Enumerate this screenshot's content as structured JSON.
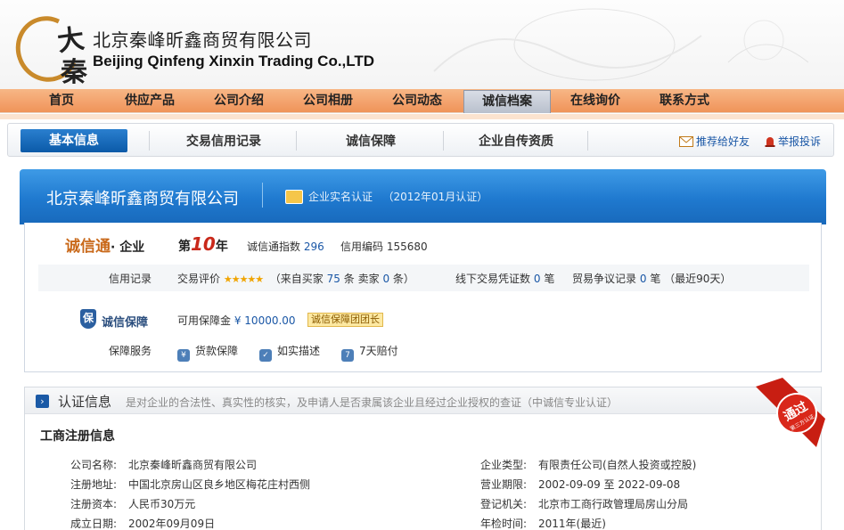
{
  "header": {
    "company_cn": "北京秦峰昕鑫商贸有限公司",
    "company_en": "Beijing Qinfeng Xinxin Trading Co.,LTD",
    "logo_chars": [
      "大",
      "秦"
    ]
  },
  "mainnav": {
    "items": [
      "首页",
      "供应产品",
      "公司介绍",
      "公司相册",
      "公司动态",
      "诚信档案",
      "在线询价",
      "联系方式"
    ],
    "active": "诚信档案"
  },
  "subtabs": {
    "items": [
      "基本信息",
      "交易信用记录",
      "诚信保障",
      "企业自传资质"
    ],
    "active": "基本信息",
    "share": "推荐给好友",
    "report": "举报投诉"
  },
  "banner": {
    "title": "北京秦峰昕鑫商贸有限公司",
    "cert_label": "企业实名认证",
    "cert_date": "（2012年01月认证）"
  },
  "credit": {
    "brand": "诚信通",
    "brand_sub": "· 企业",
    "year_prefix": "第",
    "year_num": "10",
    "year_suffix": "年",
    "index_label": "诚信通指数",
    "index_value": "296",
    "code_label": "信用编码",
    "code_value": "155680",
    "record_label": "信用记录",
    "rating_label": "交易评价",
    "stars": "★★★★★",
    "from_buyer_label": "（来自买家",
    "buyers": "75",
    "tiao1": "条",
    "seller_label": "卖家",
    "sellers": "0",
    "tiao2": "条）",
    "offline_label": "线下交易凭证数",
    "offline_value": "0",
    "bi1": "笔",
    "dispute_label": "贸易争议记录",
    "dispute_value": "0",
    "bi2": "笔",
    "recent": "（最近90天）",
    "guarantee_title": "诚信保障",
    "guarantee_amount_label": "可用保障金",
    "guarantee_amount": "¥ 10000.00",
    "guarantee_tag": "诚信保障团团长",
    "service_label": "保障服务",
    "services": [
      "货款保障",
      "如实描述",
      "7天赔付"
    ]
  },
  "cert": {
    "title": "认证信息",
    "desc": "是对企业的合法性、真实性的核实，及申请人是否隶属该企业且经过企业授权的查证",
    "source": "（中诚信专业认证）",
    "subtitle": "工商注册信息",
    "seal_text": "通过",
    "seal_sub": "第三方认证",
    "fields": [
      {
        "k": "公司名称:",
        "v": "北京秦峰昕鑫商贸有限公司"
      },
      {
        "k": "注册地址:",
        "v": "中国北京房山区良乡地区梅花庄村西侧"
      },
      {
        "k": "注册资本:",
        "v": "人民币30万元"
      },
      {
        "k": "成立日期:",
        "v": "2002年09月09日"
      }
    ],
    "fields_right": [
      {
        "k": "企业类型:",
        "v": "有限责任公司(自然人投资或控股)"
      },
      {
        "k": "营业期限:",
        "v": "2002-09-09 至 2022-09-08"
      },
      {
        "k": "登记机关:",
        "v": "北京市工商行政管理局房山分局"
      },
      {
        "k": "年检时间:",
        "v": "2011年(最近)"
      }
    ]
  }
}
